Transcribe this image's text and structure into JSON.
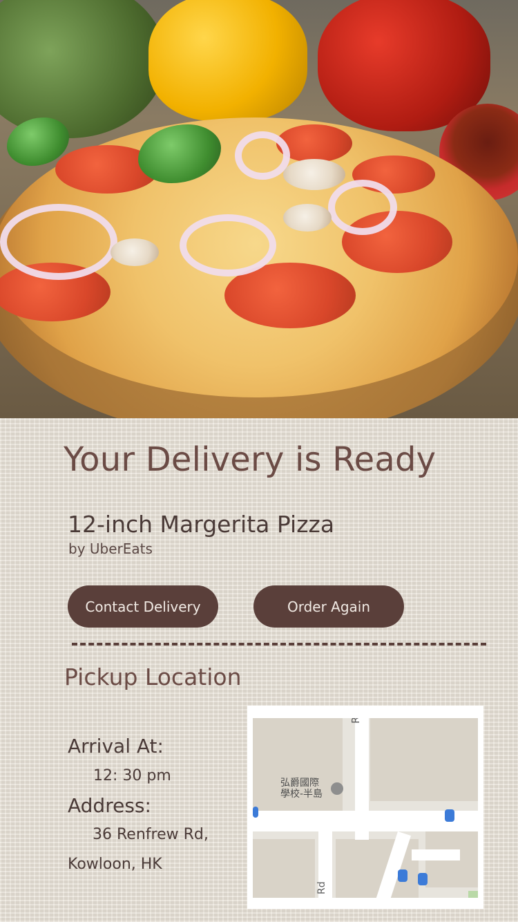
{
  "hero": {
    "image": "pizza-photo"
  },
  "delivery": {
    "title": "Your Delivery is Ready",
    "item_name": "12-inch Margerita Pizza",
    "item_by": "by UberEats"
  },
  "buttons": {
    "contact_label": "Contact Delivery",
    "order_again_label": "Order Again"
  },
  "pickup": {
    "section_title": "Pickup Location",
    "arrival_label": "Arrival At:",
    "arrival_time": "12: 30 pm",
    "address_label": "Address:",
    "address_line1": "36 Renfrew Rd,",
    "address_line2": "Kowloon, HK"
  },
  "map": {
    "school_label": "弘爵國際\n學校-半島",
    "street_label": "Renfrew R",
    "rd_label": "Rd"
  },
  "colors": {
    "primary_brown": "#5a3f3a",
    "title_brown": "#6b4b45",
    "text_dark": "#4a3a37",
    "button_text": "#f2ebe5",
    "page_bg": "#e7e1d6"
  }
}
